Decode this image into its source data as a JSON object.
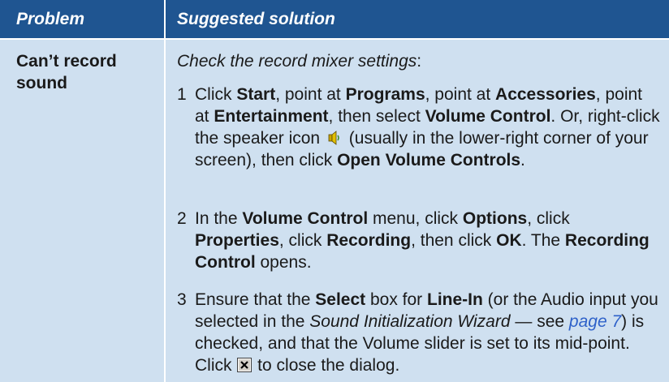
{
  "header": {
    "problem": "Problem",
    "solution": "Suggested solution"
  },
  "row": {
    "problem": "Can’t record sound",
    "intro": "Check the record mixer settings",
    "intro_colon": ":",
    "steps": [
      {
        "num": "1",
        "parts": {
          "t1": "Click ",
          "b1": "Start",
          "t2": ", point at ",
          "b2": "Programs",
          "t3": ", point at ",
          "b3": "Accessories",
          "t4": ", point at ",
          "b4": "Entertainment",
          "t5": ", then select ",
          "b5": "Volume Control",
          "t6": ". Or, right-click the speaker icon ",
          "t7": " (usually in the lower-right corner of your screen), then click ",
          "b6": "Open Volume Controls",
          "t8": "."
        }
      },
      {
        "num": "2",
        "parts": {
          "t1": "In the ",
          "b1": "Volume Control",
          "t2": " menu, click ",
          "b2": "Options",
          "t3": ", click ",
          "b3": "Properties",
          "t4": ", click ",
          "b4": "Recording",
          "t5": ", then click ",
          "b5": "OK",
          "t6": ".  The ",
          "b6": "Recording Control",
          "t7": " opens."
        }
      },
      {
        "num": "3",
        "parts": {
          "t1": "Ensure that the ",
          "b1": "Select",
          "t2": " box for ",
          "b2": "Line-In",
          "t3": " (or the Audio input you selected in the ",
          "i1": "Sound Initialization Wizard",
          "t4": " — see ",
          "link": "page 7",
          "t5": ") is checked, and that the Volume slider is set to its mid-point.  Click ",
          "t6": " to close the dialog."
        }
      }
    ]
  },
  "icons": {
    "speaker": "speaker-icon",
    "close": "close-box-icon"
  },
  "colors": {
    "header_bg": "#1f5591",
    "row_bg": "#cfe0f0",
    "link": "#2e61c9"
  }
}
